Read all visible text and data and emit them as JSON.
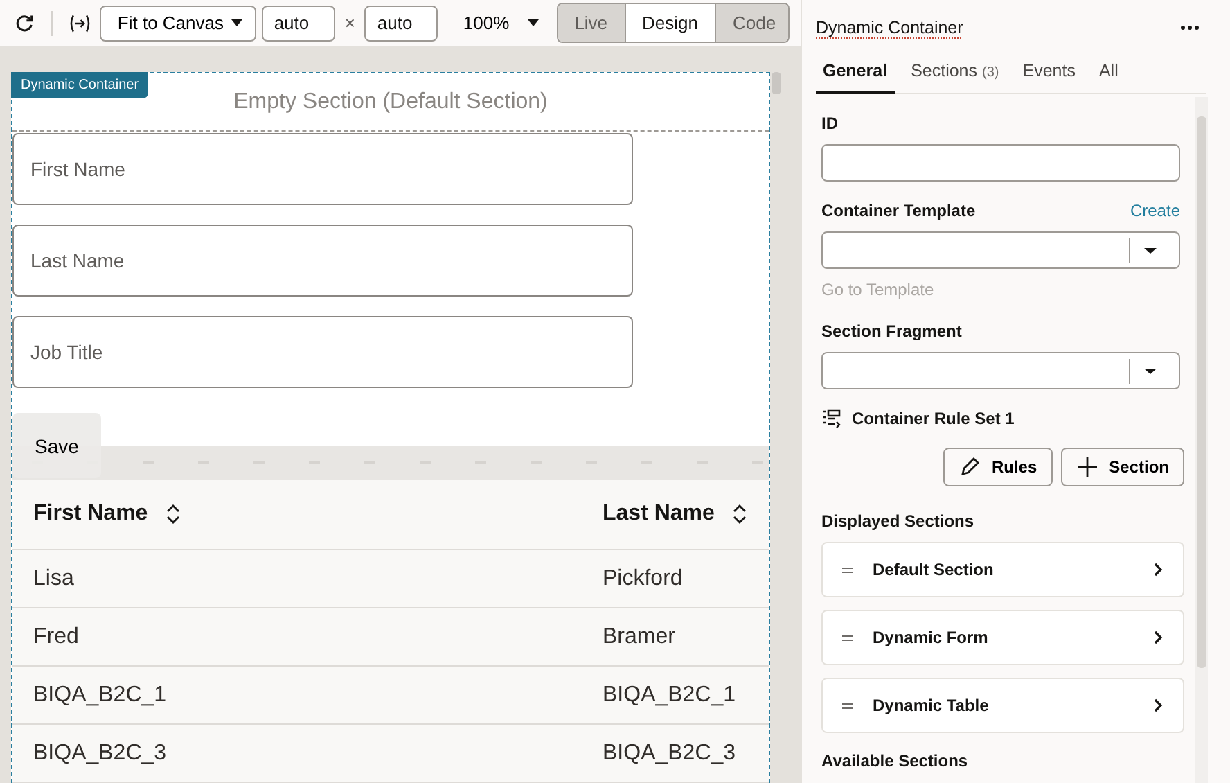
{
  "toolbar": {
    "size_mode": "Fit to Canvas",
    "width": "auto",
    "times": "×",
    "height": "auto",
    "zoom": "100%",
    "view_modes": [
      {
        "label": "Live",
        "selected": false
      },
      {
        "label": "Design",
        "selected": true
      },
      {
        "label": "Code",
        "selected": false
      }
    ]
  },
  "canvas": {
    "badge": "Dynamic Container",
    "empty_section": "Empty Section (Default Section)",
    "form_fields": [
      {
        "placeholder": "First Name"
      },
      {
        "placeholder": "Last Name"
      },
      {
        "placeholder": "Job Title"
      }
    ],
    "save_button": "Save",
    "table": {
      "columns": [
        "First Name",
        "Last Name"
      ],
      "rows": [
        [
          "Lisa",
          "Pickford"
        ],
        [
          "Fred",
          "Bramer"
        ],
        [
          "BIQA_B2C_1",
          "BIQA_B2C_1"
        ],
        [
          "BIQA_B2C_3",
          "BIQA_B2C_3"
        ]
      ]
    }
  },
  "panel": {
    "title": "Dynamic Container",
    "tabs": [
      {
        "label": "General",
        "selected": true
      },
      {
        "label": "Sections",
        "count": "(3)",
        "selected": false
      },
      {
        "label": "Events",
        "selected": false
      },
      {
        "label": "All",
        "selected": false
      }
    ],
    "id_label": "ID",
    "template_label": "Container Template",
    "create_link": "Create",
    "go_to_template": "Go to Template",
    "fragment_label": "Section Fragment",
    "rule_set": "Container Rule Set 1",
    "buttons": [
      {
        "kind": "pencil",
        "label": "Rules"
      },
      {
        "kind": "plus",
        "label": "Section"
      }
    ],
    "displayed_heading": "Displayed Sections",
    "displayed_sections": [
      "Default Section",
      "Dynamic Form",
      "Dynamic Table"
    ],
    "available_heading": "Available Sections"
  }
}
